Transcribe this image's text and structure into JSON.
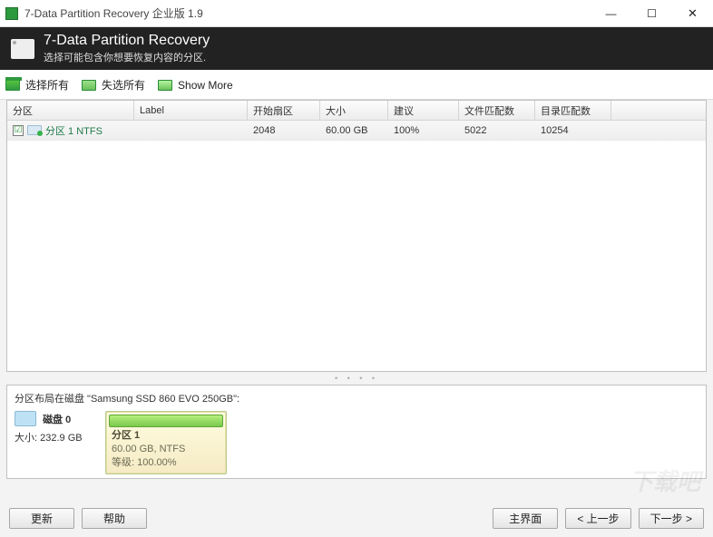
{
  "window": {
    "title": "7-Data Partition Recovery 企业版 1.9"
  },
  "header": {
    "heading": "7-Data Partition Recovery",
    "subheading": "选择可能包含你想要恢复内容的分区."
  },
  "toolbar": {
    "select_all": "选择所有",
    "deselect_all": "失选所有",
    "show_more": "Show More"
  },
  "table": {
    "columns": {
      "partition": "分区",
      "label": "Label",
      "start_sector": "开始扇区",
      "size": "大小",
      "suggestion": "建议",
      "file_matches": "文件匹配数",
      "dir_matches": "目录匹配数"
    },
    "rows": [
      {
        "checked": "☑",
        "name": "分区 1 NTFS",
        "label": "",
        "start_sector": "2048",
        "size": "60.00 GB",
        "suggestion": "100%",
        "file_matches": "5022",
        "dir_matches": "10254"
      }
    ]
  },
  "layout": {
    "title_prefix": "分区布局在磁盘 \"",
    "disk_model": "Samsung SSD 860 EVO 250GB",
    "title_suffix": "\":",
    "disk": {
      "name": "磁盘 0",
      "size_label": "大小:",
      "size_value": "232.9 GB"
    },
    "partition": {
      "title": "分区 1",
      "line1": "60.00 GB, NTFS",
      "line2_label": "等级:",
      "line2_value": "100.00%"
    }
  },
  "buttons": {
    "refresh": "更新",
    "help": "帮助",
    "main": "主界面",
    "prev": "< 上一步",
    "next": "下一步 >"
  },
  "watermark": "下载吧"
}
